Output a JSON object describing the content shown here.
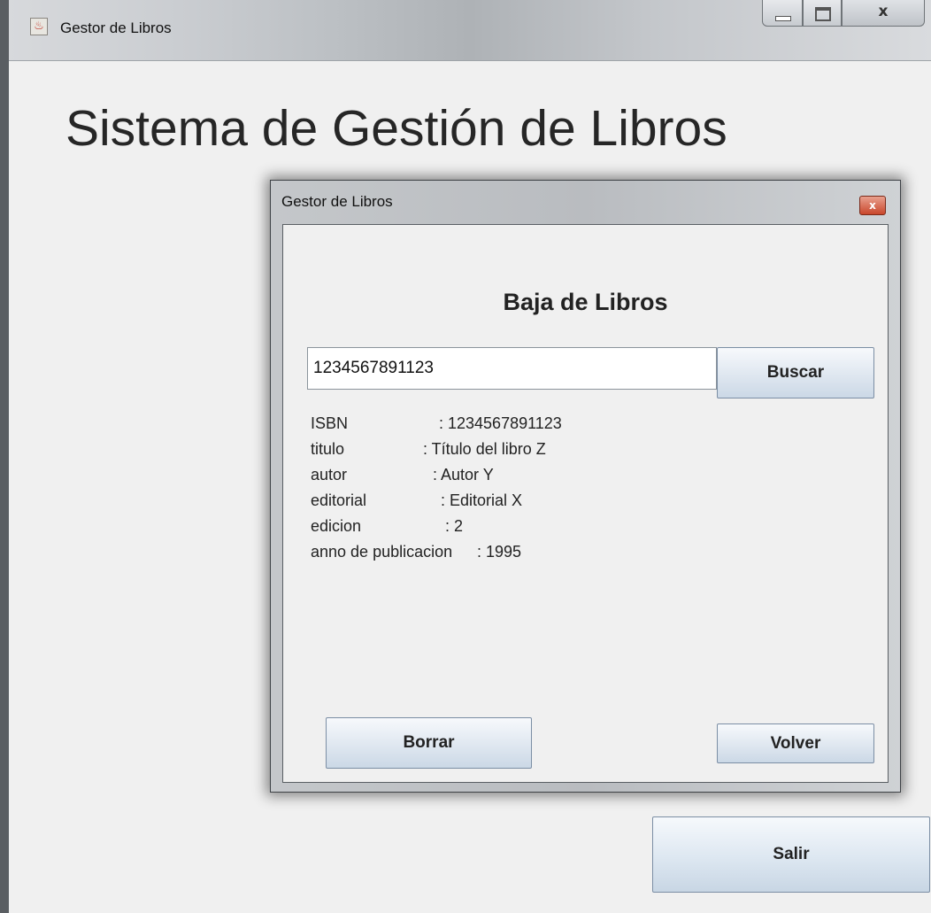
{
  "window": {
    "title": "Gestor de Libros",
    "app_icon": "java-icon"
  },
  "main": {
    "heading": "Sistema de Gestión de Libros",
    "salir_label": "Salir"
  },
  "dialog": {
    "title": "Gestor de Libros",
    "heading": "Baja de Libros",
    "search_value": "1234567891123",
    "buscar_label": "Buscar",
    "borrar_label": "Borrar",
    "volver_label": "Volver",
    "details": [
      {
        "label": "ISBN",
        "value": ": 1234567891123"
      },
      {
        "label": "titulo",
        "value": ": Título del libro Z"
      },
      {
        "label": "autor",
        "value": ": Autor Y"
      },
      {
        "label": "editorial",
        "value": ": Editorial X"
      },
      {
        "label": "edicion",
        "value": ": 2"
      },
      {
        "label": "anno de publicacion",
        "value": ": 1995"
      }
    ]
  }
}
